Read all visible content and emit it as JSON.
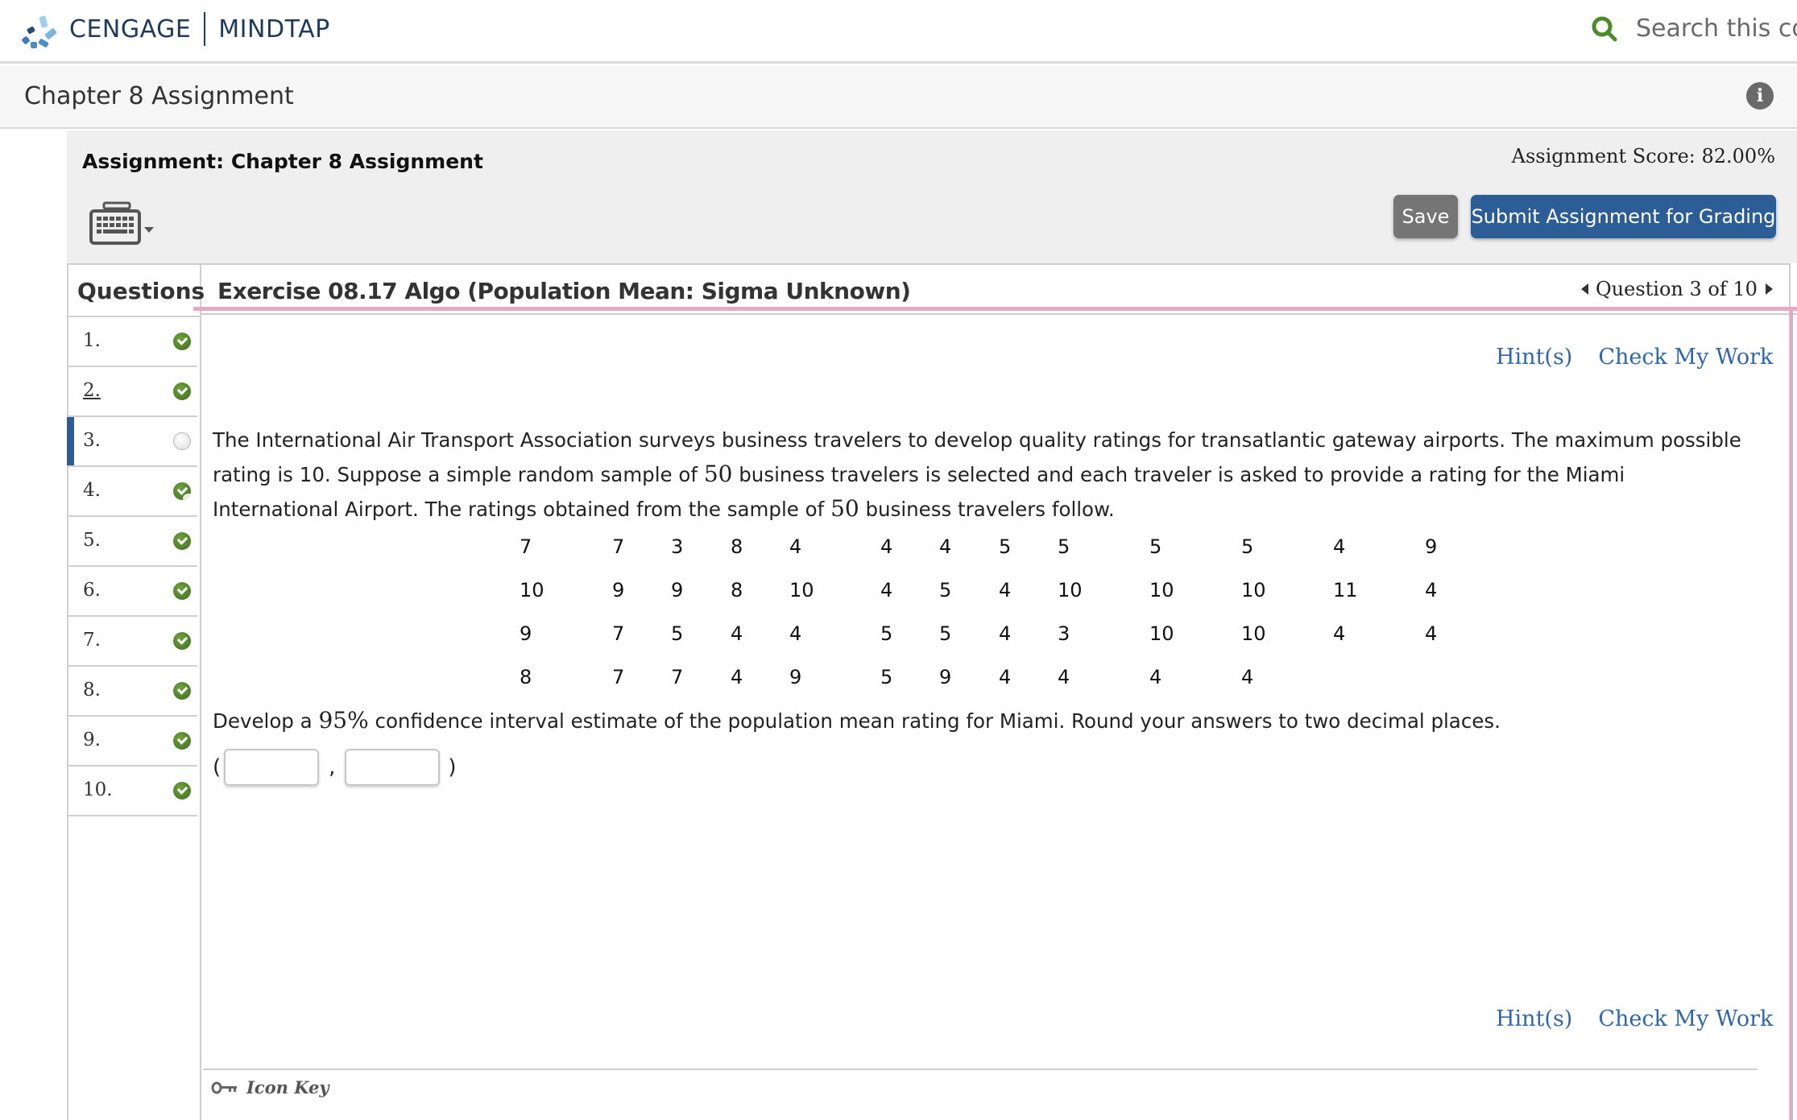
{
  "header": {
    "brand": "CENGAGE",
    "product": "MINDTAP",
    "search_placeholder": "Search this cou",
    "search_icon": "search-icon",
    "accent_color": "#4e8a2c"
  },
  "subheader": {
    "title": "Chapter 8 Assignment",
    "info_icon": "info-icon"
  },
  "assignment": {
    "title": "Assignment: Chapter 8 Assignment",
    "score": "Assignment Score: 82.00%",
    "keyboard_icon": "keyboard-icon",
    "save_label": "Save",
    "submit_label": "Submit Assignment for Grading",
    "submit_color": "#2d5d97"
  },
  "sidebar": {
    "heading": "Questions",
    "items": [
      {
        "label": "1.",
        "status": "complete"
      },
      {
        "label": "2.",
        "status": "complete",
        "link": true
      },
      {
        "label": "3.",
        "status": "not-answered",
        "active": true
      },
      {
        "label": "4.",
        "status": "partial"
      },
      {
        "label": "5.",
        "status": "complete"
      },
      {
        "label": "6.",
        "status": "complete"
      },
      {
        "label": "7.",
        "status": "complete"
      },
      {
        "label": "8.",
        "status": "complete"
      },
      {
        "label": "9.",
        "status": "complete"
      },
      {
        "label": "10.",
        "status": "complete"
      }
    ]
  },
  "exercise": {
    "title": "Exercise 08.17 Algo (Population Mean: Sigma Unknown)",
    "nav": "Question 3 of 10",
    "hint_label": "Hint(s)",
    "check_label": "Check My Work",
    "text_part1": "The International Air Transport Association surveys business travelers to develop quality ratings for transatlantic gateway airports. The maximum possible rating is 10. Suppose a simple random sample of ",
    "sample_size": "50",
    "text_part2": " business travelers is selected and each traveler is asked to provide a rating for the Miami International Airport. The ratings obtained from the sample of ",
    "text_part3": " business travelers follow.",
    "ratings": [
      [
        "7",
        "7",
        "3",
        "8",
        "4",
        "4",
        "4",
        "5",
        "5",
        "5",
        "5",
        "4",
        "9"
      ],
      [
        "10",
        "9",
        "9",
        "8",
        "10",
        "4",
        "5",
        "4",
        "10",
        "10",
        "10",
        "11",
        "4"
      ],
      [
        "9",
        "7",
        "5",
        "4",
        "4",
        "5",
        "5",
        "4",
        "3",
        "10",
        "10",
        "4",
        "4"
      ],
      [
        "8",
        "7",
        "7",
        "4",
        "9",
        "5",
        "9",
        "4",
        "4",
        "4",
        "4"
      ]
    ],
    "prompt_part1": "Develop a ",
    "confidence": "95%",
    "prompt_part2": " confidence interval estimate of the population mean rating for Miami. Round your answers to two decimal places.",
    "answer_open": "(",
    "answer_sep": ",",
    "answer_close": ")",
    "lower_value": "",
    "upper_value": ""
  },
  "footer": {
    "icon_key_label": "Icon Key"
  }
}
